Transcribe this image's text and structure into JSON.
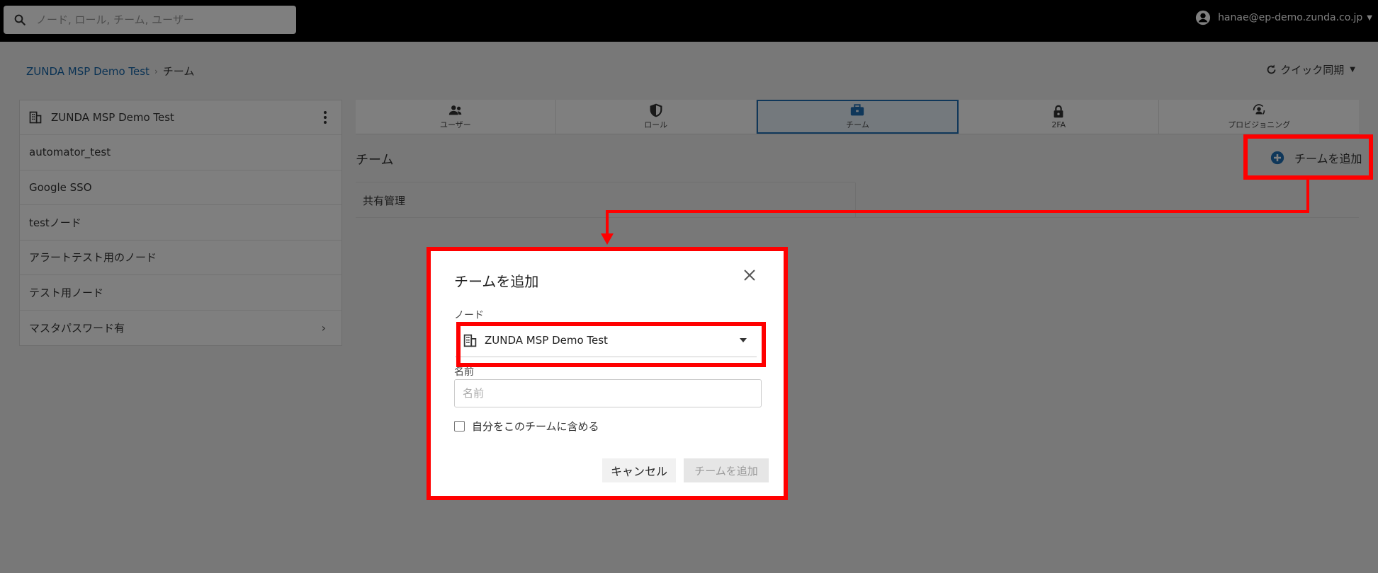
{
  "topbar": {
    "search_placeholder": "ノード, ロール, チーム, ユーザー",
    "user_email": "hanae@ep-demo.zunda.co.jp"
  },
  "breadcrumb": {
    "root": "ZUNDA MSP Demo Test",
    "current": "チーム"
  },
  "quick_sync": {
    "label": "クイック同期"
  },
  "sidebar": {
    "root": "ZUNDA MSP Demo Test",
    "nodes": [
      {
        "label": "automator_test"
      },
      {
        "label": "Google SSO"
      },
      {
        "label": "testノード"
      },
      {
        "label": "アラートテスト用のノード"
      },
      {
        "label": "テスト用ノード"
      },
      {
        "label": "マスタパスワード有"
      }
    ]
  },
  "tabs": [
    {
      "label": "ユーザー",
      "icon": "users-icon"
    },
    {
      "label": "ロール",
      "icon": "shield-icon"
    },
    {
      "label": "チーム",
      "icon": "briefcase-icon",
      "active": true
    },
    {
      "label": "2FA",
      "icon": "lock-icon"
    },
    {
      "label": "プロビジョニング",
      "icon": "provisioning-icon"
    }
  ],
  "main": {
    "section_title": "チーム",
    "add_team_label": "チームを追加",
    "teams": [
      {
        "name": "共有管理"
      }
    ]
  },
  "dialog": {
    "title": "チームを追加",
    "node_label": "ノード",
    "node_value": "ZUNDA MSP Demo Test",
    "name_label": "名前",
    "name_placeholder": "名前",
    "checkbox_label": "自分をこのチームに含める",
    "cancel_label": "キャンセル",
    "submit_label": "チームを追加"
  },
  "colors": {
    "highlight": "#ff0000",
    "accent": "#1f6fb5",
    "link": "#1565a8"
  }
}
